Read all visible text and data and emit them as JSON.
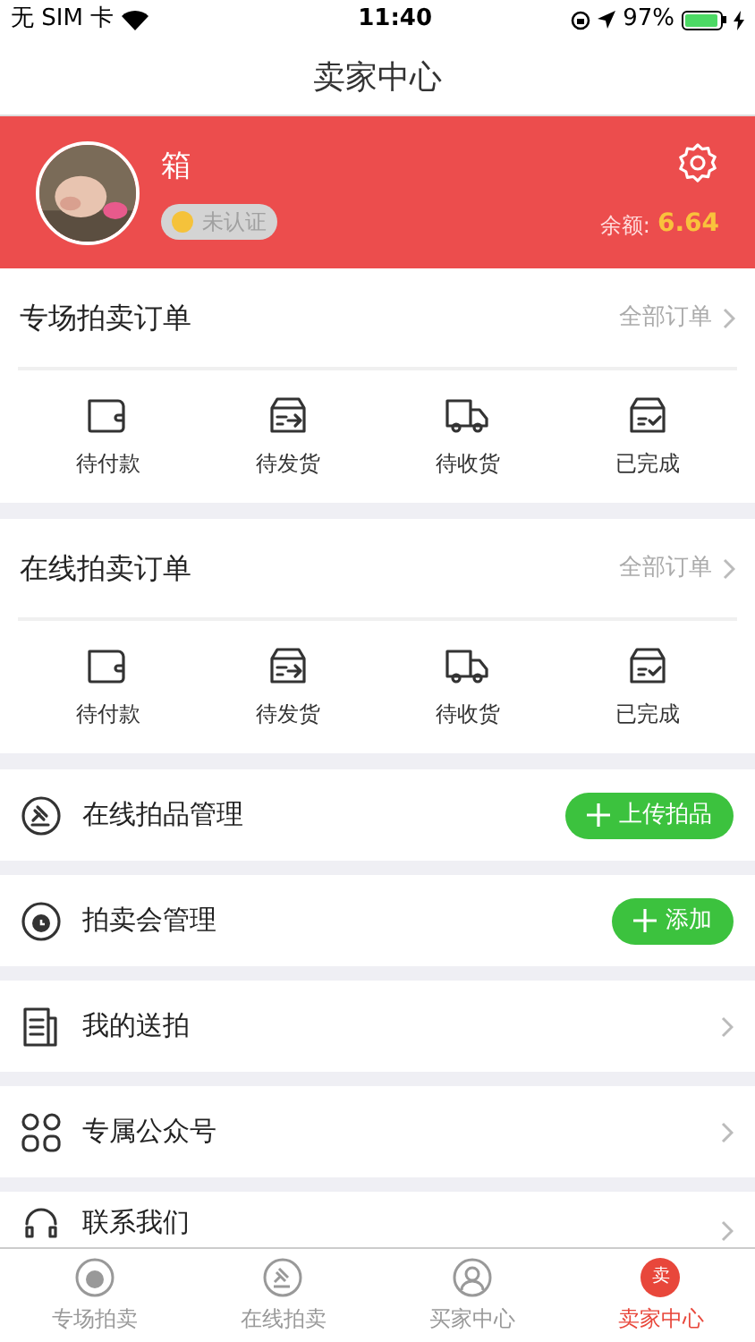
{
  "status_bar": {
    "carrier": "无 SIM 卡",
    "time": "11:40",
    "battery": "97%"
  },
  "nav": {
    "title": "卖家中心"
  },
  "profile": {
    "name": "箱",
    "badge": "未认证",
    "balance_label": "余额:",
    "balance": "6.64"
  },
  "order_sections": [
    {
      "title": "专场拍卖订单",
      "link": "全部订单",
      "items": [
        {
          "kind": "wallet",
          "label": "待付款"
        },
        {
          "kind": "ship",
          "label": "待发货"
        },
        {
          "kind": "truck",
          "label": "待收货"
        },
        {
          "kind": "done",
          "label": "已完成"
        }
      ]
    },
    {
      "title": "在线拍卖订单",
      "link": "全部订单",
      "items": [
        {
          "kind": "wallet",
          "label": "待付款"
        },
        {
          "kind": "ship",
          "label": "待发货"
        },
        {
          "kind": "truck",
          "label": "待收货"
        },
        {
          "kind": "done",
          "label": "已完成"
        }
      ]
    }
  ],
  "menu": [
    {
      "kind": "gavel",
      "label": "在线拍品管理",
      "button": "上传拍品"
    },
    {
      "kind": "clock",
      "label": "拍卖会管理",
      "button": "添加"
    },
    {
      "kind": "doc",
      "label": "我的送拍"
    },
    {
      "kind": "grid",
      "label": "专属公众号"
    },
    {
      "kind": "headset",
      "label": "联系我们"
    }
  ],
  "tabs": [
    {
      "kind": "clock",
      "label": "专场拍卖",
      "selected": false
    },
    {
      "kind": "gavel",
      "label": "在线拍卖",
      "selected": false
    },
    {
      "kind": "user",
      "label": "买家中心",
      "selected": false
    },
    {
      "kind": "badge",
      "badge": "卖",
      "label": "卖家中心",
      "selected": true
    }
  ]
}
